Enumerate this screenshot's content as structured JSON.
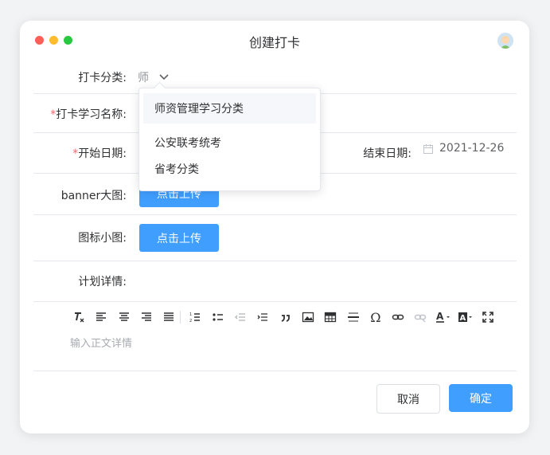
{
  "window": {
    "title": "创建打卡"
  },
  "form": {
    "category": {
      "label": "打卡分类:",
      "value": "师"
    },
    "name": {
      "label": "打卡学习名称:",
      "required_mark": "*"
    },
    "start_date": {
      "label": "开始日期:",
      "required_mark": "*"
    },
    "end_date": {
      "label": "结束日期:",
      "value": "2021-12-26"
    },
    "banner": {
      "label": "banner大图:",
      "button": "点击上传"
    },
    "icon": {
      "label": "图标小图:",
      "button": "点击上传"
    },
    "detail": {
      "label": "计划详情:"
    }
  },
  "dropdown": {
    "options": [
      "师资管理学习分类",
      "公安联考统考",
      "省考分类"
    ],
    "highlighted_index": 0
  },
  "editor": {
    "placeholder": "输入正文详情",
    "toolbar_icons": [
      "clear-format-icon",
      "align-left-icon",
      "align-center-icon",
      "align-right-icon",
      "align-justify-icon",
      "ordered-list-icon",
      "bullet-list-icon",
      "outdent-icon",
      "indent-icon",
      "blockquote-icon",
      "image-icon",
      "table-icon",
      "horizontal-rule-icon",
      "special-char-icon",
      "link-icon",
      "unlink-icon",
      "font-color-icon",
      "background-color-icon",
      "fullscreen-icon"
    ]
  },
  "footer": {
    "cancel": "取消",
    "confirm": "确定"
  },
  "colors": {
    "primary": "#409eff",
    "required": "#f56c6c",
    "close": "#fe5f57",
    "minimize": "#febc2e",
    "zoom": "#28c840"
  }
}
